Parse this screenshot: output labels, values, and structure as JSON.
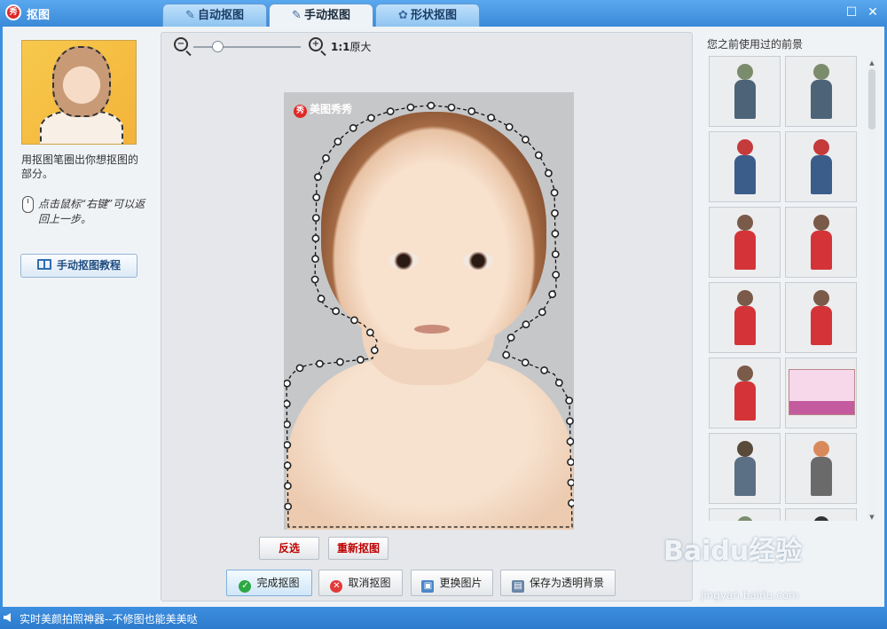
{
  "app": {
    "title": "抠图",
    "icon": "meitu-logo-icon"
  },
  "tabs": [
    {
      "label": "自动抠图",
      "icon": "brush-icon",
      "active": false
    },
    {
      "label": "手动抠图",
      "icon": "lasso-brush-icon",
      "active": true
    },
    {
      "label": "形状抠图",
      "icon": "shape-icon",
      "active": false
    }
  ],
  "left": {
    "hint": "用抠图笔圈出你想抠图的部分。",
    "handwritten": "点击鼠标“右键”可以返回上一步。",
    "tutorial_button": "手动抠图教程"
  },
  "zoom": {
    "ratio_bold": "1:1",
    "ratio_label": "原大",
    "level": 0.22
  },
  "photo": {
    "watermark": "美图秀秀"
  },
  "buttons": {
    "invert": "反选",
    "redo": "重新抠图",
    "finish": "完成抠图",
    "cancel": "取消抠图",
    "change_image": "更换图片",
    "save_transparent": "保存为透明背景"
  },
  "right": {
    "title": "您之前使用过的前景",
    "items": [
      "old-man-cane-figure",
      "old-man-figure",
      "boy-walking-figure",
      "boy-walking-figure",
      "girl-red-dress-figure",
      "girl-red-dress-figure",
      "girl-red-dress-figure",
      "girl-red-dress-figure",
      "girl-red-dress-figure",
      "bedroom-picture",
      "man-standing-figure",
      "boy-bicycle-figure",
      "old-man-figure",
      "dark-figure"
    ]
  },
  "status": {
    "text": "实时美颜拍照神器--不修图也能美美哒"
  },
  "watermark": {
    "brand": "Baidu经验",
    "url": "jingyan.baidu.com"
  },
  "colors": {
    "titlebar": "#3a8ad8",
    "accent_red": "#c00000",
    "panel": "#f0f3f6"
  }
}
